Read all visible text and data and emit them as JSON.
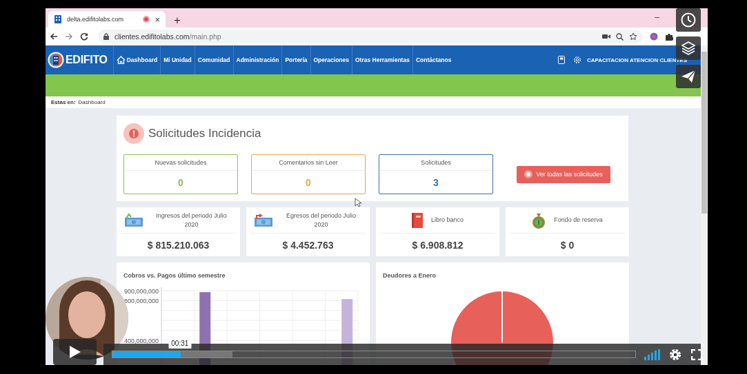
{
  "browser": {
    "tab": {
      "title": "delta.edifitolabs.com",
      "close": "×"
    },
    "new_tab": "+",
    "minimize": "–",
    "address": "clientes.edifitolabs.com/main.php"
  },
  "site_nav": {
    "logo": "EDIFITO",
    "items": [
      {
        "label": "Dashboard",
        "kind": "home"
      },
      {
        "label": "Mi Unidad",
        "kind": "text"
      },
      {
        "label": "Comunidad",
        "kind": "text"
      },
      {
        "label": "Administración",
        "kind": "text"
      },
      {
        "label": "Portería",
        "kind": "text"
      },
      {
        "label": "Operaciones",
        "kind": "text"
      },
      {
        "label": "Otras Herramientas",
        "kind": "text"
      },
      {
        "label": "Contáctanos",
        "kind": "text"
      }
    ],
    "user": "CAPACITACION ATENCION CLIENTES"
  },
  "breadcrumb": {
    "label": "Estás en:",
    "page": "Dashboard"
  },
  "requests": {
    "title": "Solicitudes Incidencia",
    "counters": [
      {
        "label": "Nuevas solicitudes",
        "value": "0",
        "color": "#8cc152"
      },
      {
        "label": "Comentarios sin Leer",
        "value": "0",
        "color": "#eaa64a"
      },
      {
        "label": "Solicitudes",
        "value": "3",
        "color": "#3a6fa8"
      }
    ],
    "button": "Ver todas las solicitudes"
  },
  "stats": [
    {
      "kind": "income",
      "label": "Ingresos del periodo Julio 2020",
      "value": "$ 815.210.063"
    },
    {
      "kind": "expense",
      "label": "Egresos del periodo Julio 2020",
      "value": "$ 4.452.763"
    },
    {
      "kind": "book",
      "label": "Libro banco",
      "value": "$ 6.908.812"
    },
    {
      "kind": "reserve",
      "label": "Fondo de reserva",
      "value": "$ 0"
    }
  ],
  "charts": [
    {
      "kind": "bar",
      "chart_data": {
        "type": "bar",
        "title": "Cobros vs. Pagos último semestre",
        "ylim": [
          0,
          900000000
        ],
        "yticks": [
          {
            "value": 900000000,
            "label": "900,000,000"
          },
          {
            "value": 800000000,
            "label": "800,000,000"
          },
          {
            "value": 400000000,
            "label": "400,000,000"
          }
        ],
        "series": [
          {
            "color": "#8e72b0",
            "values": [
              null,
              885000000,
              null,
              null,
              null,
              null
            ]
          },
          {
            "color": "#c5b3dc",
            "values": [
              null,
              null,
              null,
              null,
              null,
              815000000
            ]
          }
        ]
      }
    },
    {
      "kind": "pie",
      "title": "Deudores a Enero"
    }
  ],
  "video": {
    "time": "00:31",
    "progress": {
      "level": 0.13
    },
    "buffer": {
      "level": 0.23
    }
  }
}
